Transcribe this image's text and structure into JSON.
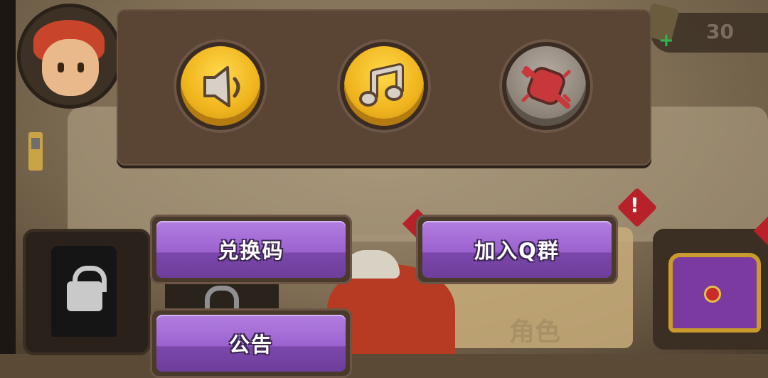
{
  "settings": {
    "sound_icon": "speaker-icon",
    "music_icon": "music-note-icon",
    "vibration_icon": "vibration-off-icon"
  },
  "menu": {
    "redeem_label": "兑换码",
    "join_group_label": "加入Q群",
    "announcement_label": "公告"
  },
  "hud": {
    "currency_value": "30",
    "role_label": "角色"
  },
  "colors": {
    "button_gold": "#f0b51e",
    "button_off": "#8f857b",
    "button_purple": "#9b62cf",
    "panel": "#5a4535",
    "alert_red": "#b8202a"
  }
}
